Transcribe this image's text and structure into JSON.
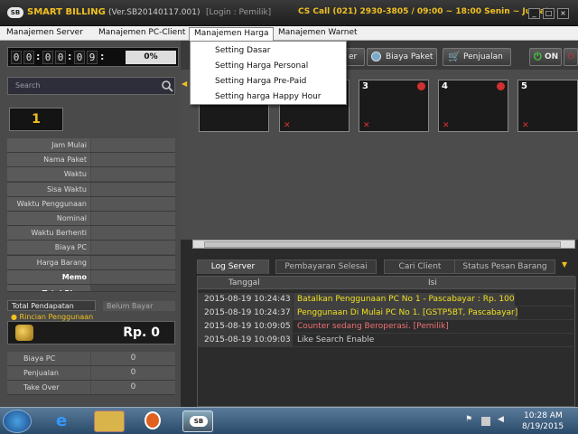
{
  "title_bar": {
    "logo": "SB",
    "app_name": "SMART BILLING",
    "version": "(Ver.SB20140117.001)",
    "login": "[Login : Pemilik]",
    "cs_call": "CS Call (021) 2930-3805 / 09:00 ~ 18:00 Senin ~ Jumat"
  },
  "menubar": {
    "items": [
      "Manajemen Server",
      "Manajemen PC-Client",
      "Manajemen Harga",
      "Manajemen Warnet"
    ]
  },
  "dropdown": {
    "items": [
      "Setting Dasar",
      "Setting Harga Personal",
      "Setting Harga Pre-Paid",
      "Setting harga Happy Hour"
    ]
  },
  "timer": {
    "digits": [
      "0",
      "0",
      "0",
      "0",
      "0",
      "9"
    ],
    "percent": "0%"
  },
  "search": {
    "label": "Search",
    "placeholder": ""
  },
  "pc_number": "1",
  "info_labels": [
    "Jam Mulai",
    "Nama Paket",
    "Waktu",
    "Sisa Waktu",
    "Waktu Penggunaan",
    "Nominal",
    "Waktu Berhenti",
    "Biaya PC",
    "Harga Barang",
    "Memo",
    "Total Biaya"
  ],
  "left_tabs": {
    "total": "Total Pendapatan",
    "belum": "Belum Bayar"
  },
  "rincian": "Rincian Penggunaan",
  "total_rp": "Rp. 0",
  "summary_rows": [
    {
      "label": "Biaya PC",
      "value": "0"
    },
    {
      "label": "Penjualan",
      "value": "0"
    },
    {
      "label": "Take Over",
      "value": "0"
    }
  ],
  "toolbar": {
    "btn_partial": "er",
    "paket": "Biaya Paket",
    "penjualan": "Penjualan",
    "on": "ON"
  },
  "pcs": [
    {
      "num": "",
      "x": false
    },
    {
      "num": "",
      "x": true
    },
    {
      "num": "3",
      "x": true
    },
    {
      "num": "4",
      "x": true
    },
    {
      "num": "5",
      "x": true
    }
  ],
  "log_tabs": [
    "Log Server",
    "Pembayaran Selesai",
    "Cari Client",
    "Status Pesan Barang"
  ],
  "log_columns": {
    "date": "Tanggal",
    "info": "Isi"
  },
  "log_rows": [
    {
      "date": "2015-08-19 10:24:43",
      "info": "Batalkan Penggunaan PC No 1 - Pascabayar : Rp. 100",
      "color": "#f0e020",
      "hl": true
    },
    {
      "date": "2015-08-19 10:24:37",
      "info": "Penggunaan Di Mulai PC No 1. [GSTP5BT, Pascabayar]",
      "color": "#f0e020",
      "hl": true
    },
    {
      "date": "2015-08-19 10:09:05",
      "info": "Counter sedang Beroperasi. [Pemilik]",
      "color": "#f07070",
      "hl": false
    },
    {
      "date": "2015-08-19 10:09:03",
      "info": "Like Search Enable",
      "color": "#cccccc",
      "hl": false
    }
  ],
  "clock": {
    "time": "10:28 AM",
    "date": "8/19/2015"
  },
  "colors": {
    "accent": "#f0c020",
    "log_yellow": "#f0e020",
    "log_red": "#f07070"
  }
}
